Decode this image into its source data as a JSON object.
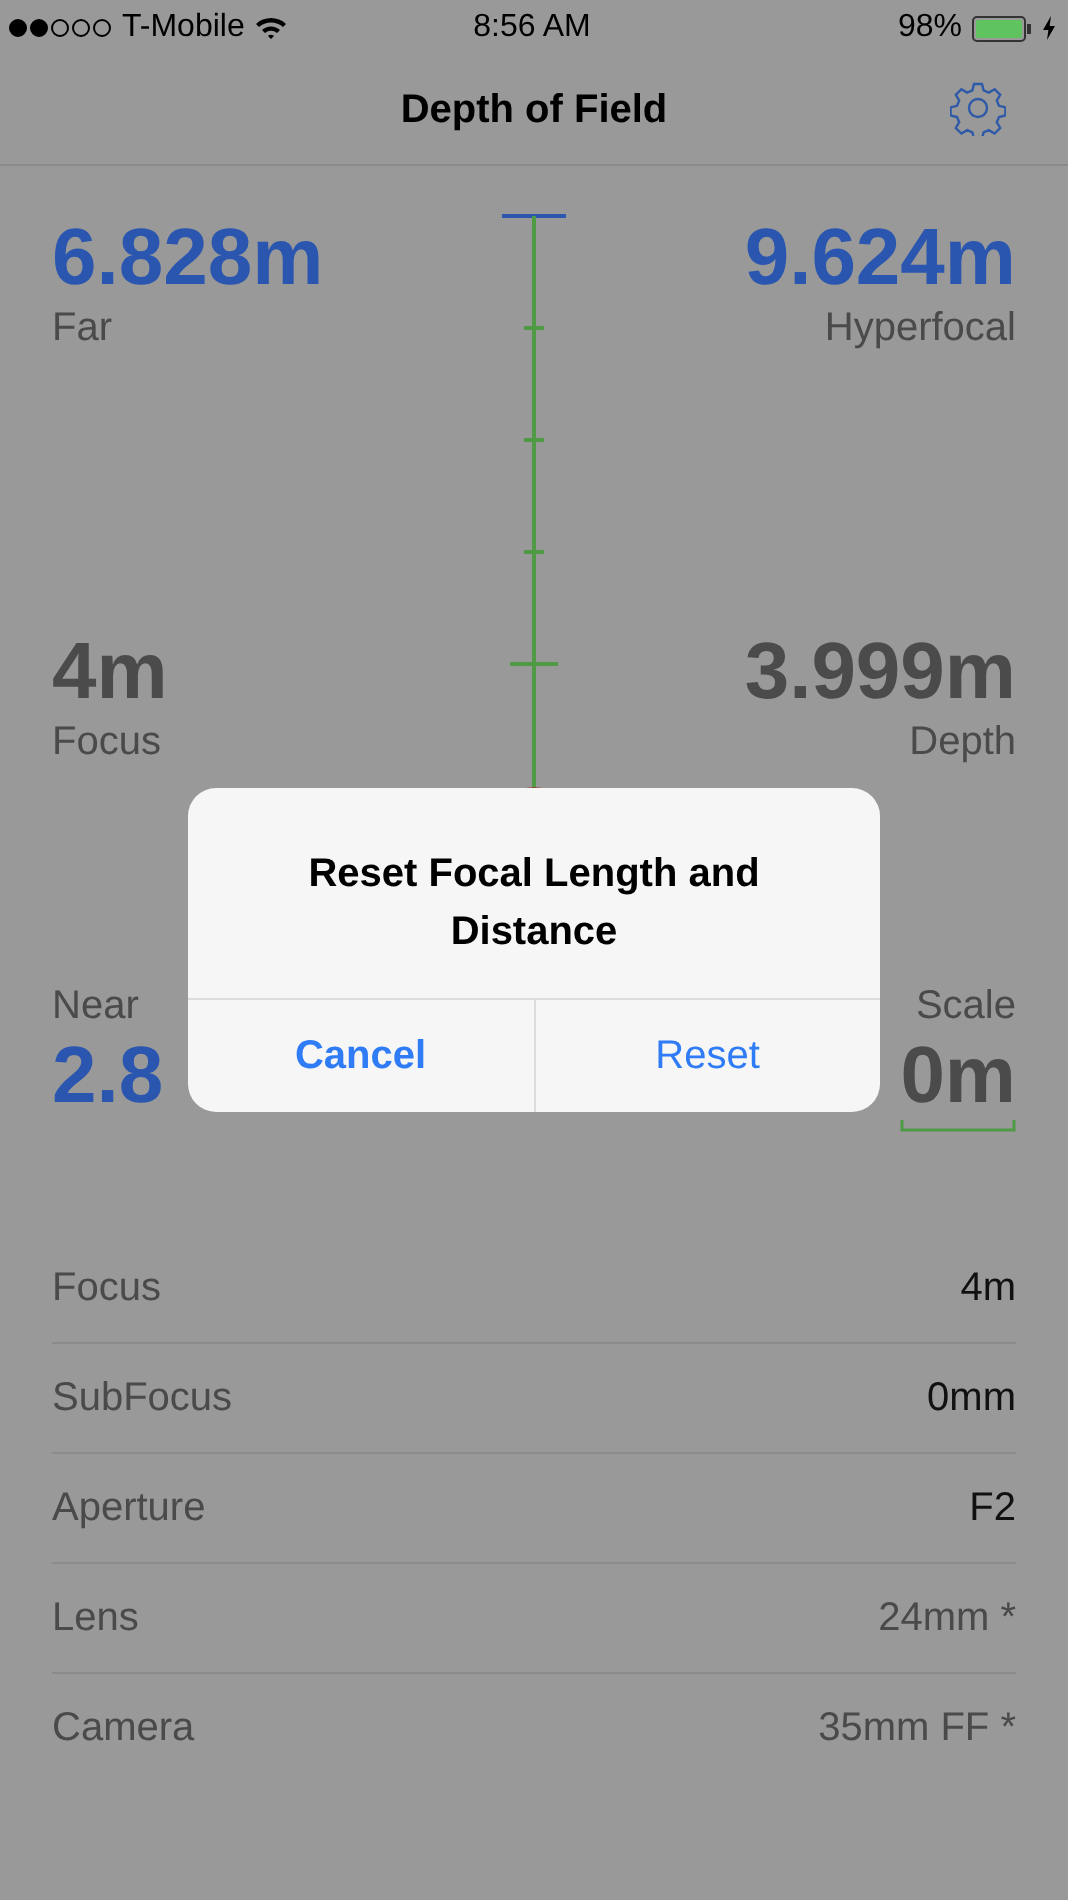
{
  "status_bar": {
    "carrier": "T-Mobile",
    "time": "8:56 AM",
    "battery": "98%"
  },
  "nav": {
    "title": "Depth of Field"
  },
  "gauge": {
    "far": {
      "value": "6.828m",
      "label": "Far"
    },
    "hyperfocal": {
      "value": "9.624m",
      "label": "Hyperfocal"
    },
    "focus": {
      "value": "4m",
      "label": "Focus"
    },
    "depth": {
      "value": "3.999m",
      "label": "Depth"
    },
    "near": {
      "value": "2.8",
      "label": "Near"
    },
    "scale": {
      "value": "0m",
      "label": "Scale"
    }
  },
  "settings": [
    {
      "label": "Focus",
      "value": "4m",
      "dimmed": false
    },
    {
      "label": "SubFocus",
      "value": "0mm",
      "dimmed": false
    },
    {
      "label": "Aperture",
      "value": "F2",
      "dimmed": false
    },
    {
      "label": "Lens",
      "value": "24mm *",
      "dimmed": true
    },
    {
      "label": "Camera",
      "value": "35mm FF *",
      "dimmed": true
    }
  ],
  "alert": {
    "title": "Reset Focal Length and Distance",
    "buttons": [
      {
        "label": "Cancel",
        "kind": "cancel"
      },
      {
        "label": "Reset",
        "kind": "default"
      }
    ]
  }
}
